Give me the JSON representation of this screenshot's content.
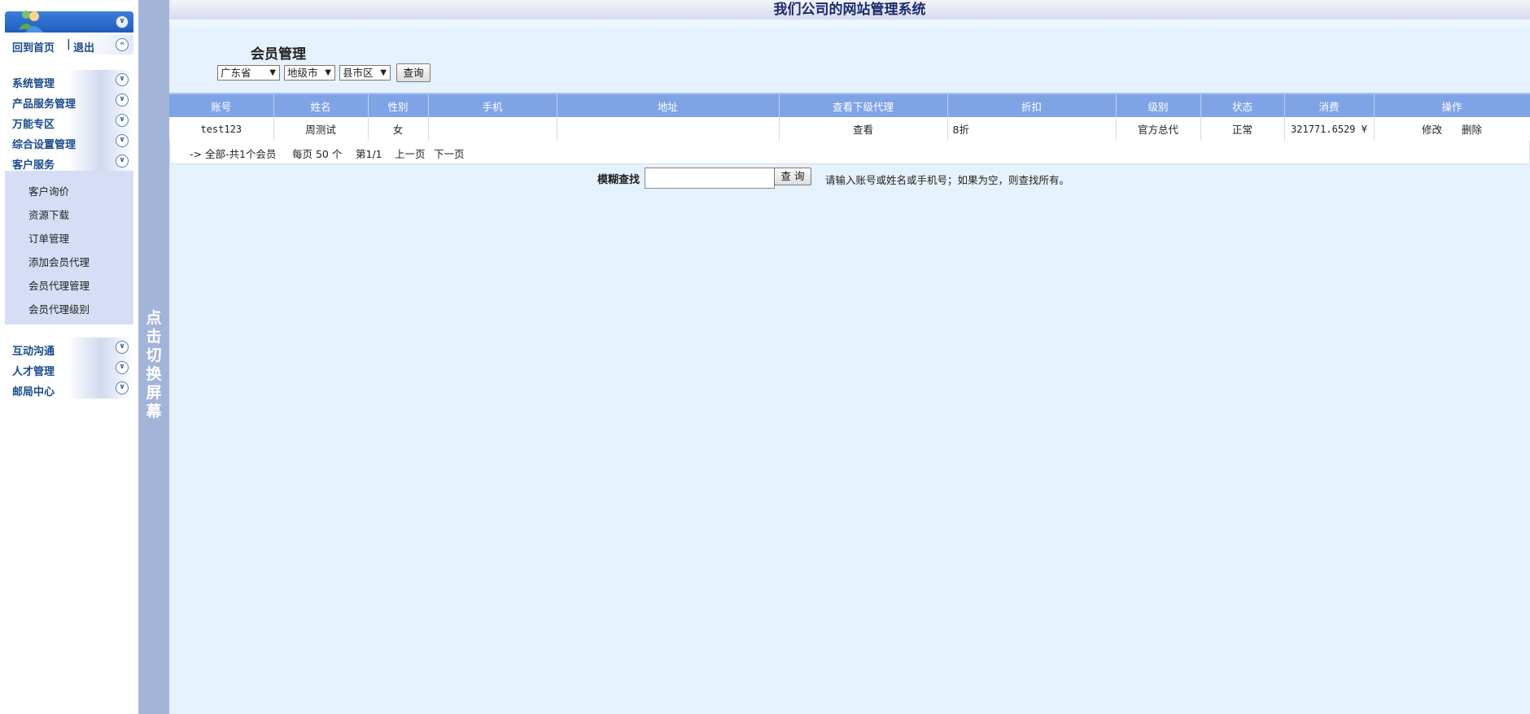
{
  "header": {
    "title": "我们公司的网站管理系统"
  },
  "sidebar": {
    "links": {
      "home": "回到首页",
      "separator": "|",
      "logout": "退出"
    },
    "groups_top": [
      "系统管理",
      "产品服务管理",
      "万能专区",
      "综合设置管理",
      "客户服务"
    ],
    "submenu": [
      "客户询价",
      "资源下载",
      "订单管理",
      "添加会员代理",
      "会员代理管理",
      "会员代理级别"
    ],
    "groups_bottom": [
      "互动沟通",
      "人才管理",
      "邮局中心"
    ],
    "toggle_text": "点击切换屏幕"
  },
  "main": {
    "page_title": "会员管理",
    "filters": {
      "province": "广东省",
      "city": "地级市",
      "district": "县市区",
      "query_button": "查询"
    },
    "table": {
      "headers": [
        "账号",
        "姓名",
        "性别",
        "手机",
        "地址",
        "查看下级代理",
        "折扣",
        "级别",
        "状态",
        "消费",
        "操作"
      ],
      "rows": [
        {
          "account": "test123",
          "name": "周测试",
          "gender": "女",
          "phone": "",
          "address": "",
          "view_sub": "查看",
          "discount": "8折",
          "level": "官方总代",
          "status": "正常",
          "spend": "321771.6529 ¥",
          "edit": "修改",
          "delete": "删除"
        }
      ]
    },
    "pager": {
      "summary": "-> 全部-共1个会员",
      "per_page": "每页 50 个",
      "page": "第1/1",
      "prev": "上一页",
      "next": "下一页"
    },
    "search": {
      "label": "模糊查找",
      "input_value": "",
      "button": "查 询",
      "hint": "请输入账号或姓名或手机号；如果为空，则查找所有。"
    }
  },
  "colors": {
    "header_bg": "#7fa4e6",
    "main_bg": "#e5f1fd",
    "toggle_bg": "#a3b4d9",
    "menu_text": "#1a4a8c"
  }
}
